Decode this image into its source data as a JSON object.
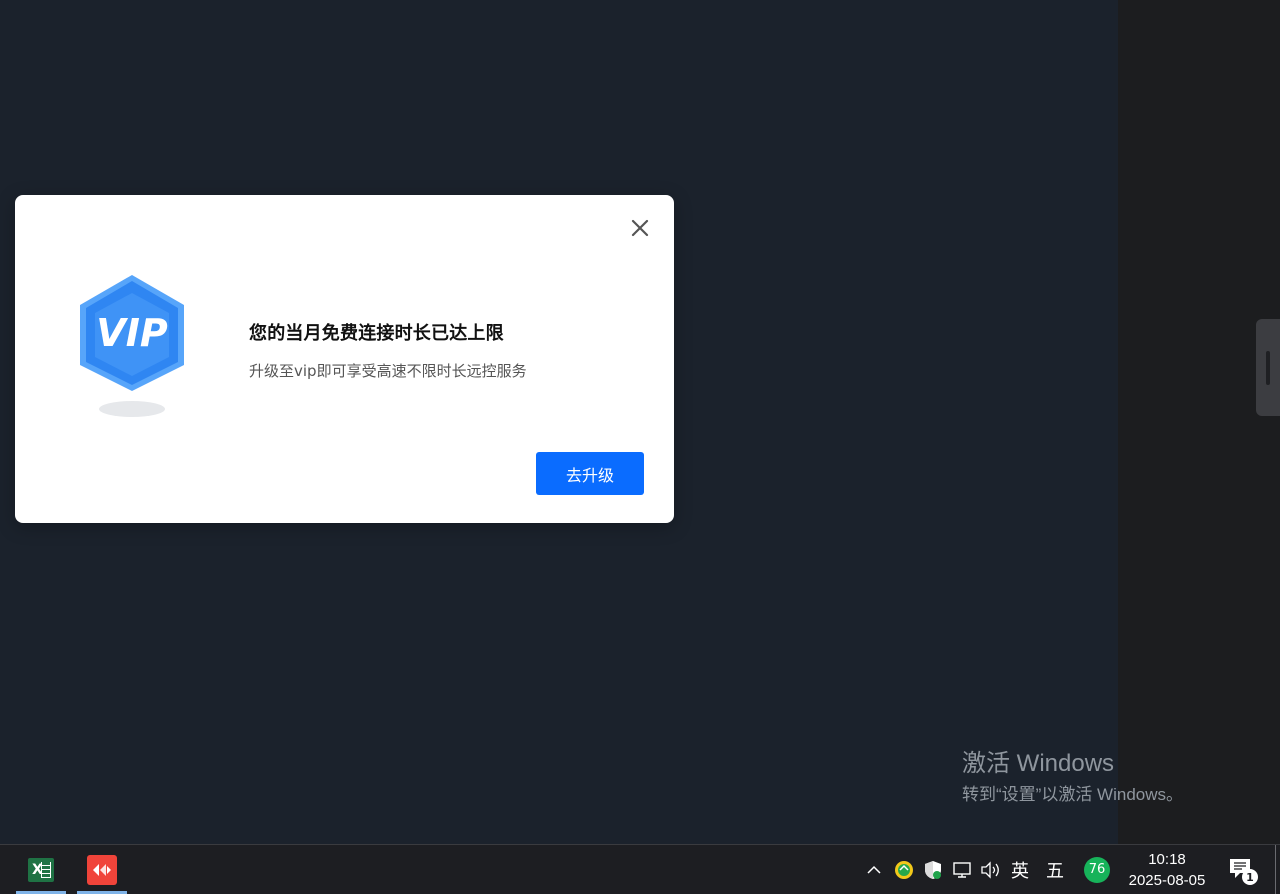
{
  "dialog": {
    "title": "您的当月免费连接时长已达上限",
    "subtitle": "升级至vip即可享受高速不限时长远控服务",
    "upgrade_label": "去升级",
    "badge_text": "VIP",
    "close_icon": "close-icon"
  },
  "watermark": {
    "title": "激活 Windows",
    "subtitle": "转到“设置”以激活 Windows。"
  },
  "taskbar": {
    "apps": [
      {
        "name": "excel-icon"
      },
      {
        "name": "remote-desktop-icon"
      }
    ],
    "tray": {
      "ime_mode": "英",
      "ime_layout": "五",
      "battery_value": "76",
      "time": "10:18",
      "date": "2025-08-05",
      "notification_count": "1"
    }
  },
  "colors": {
    "accent": "#0a6cff",
    "background": "#1b222c",
    "vip_blue": "#3d8df5"
  }
}
